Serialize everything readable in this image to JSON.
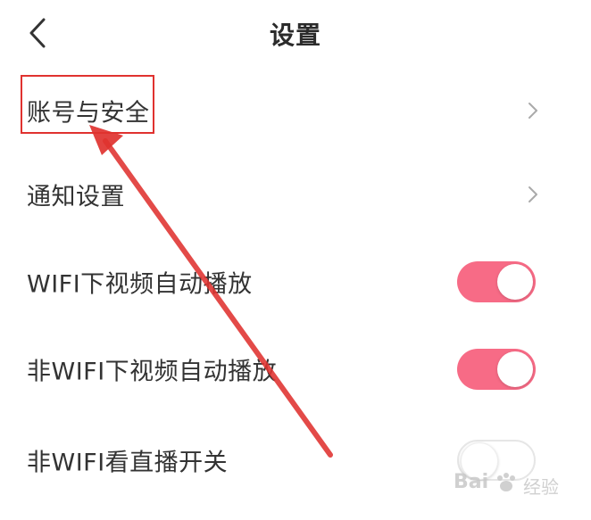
{
  "header": {
    "title": "设置",
    "back_icon": "chevron-left-icon"
  },
  "rows": [
    {
      "label": "账号与安全",
      "control": "chevron",
      "icon": "chevron-right-icon"
    },
    {
      "label": "通知设置",
      "control": "chevron",
      "icon": "chevron-right-icon"
    },
    {
      "label": "WIFI下视频自动播放",
      "control": "toggle",
      "state": "on"
    },
    {
      "label": "非WIFI下视频自动播放",
      "control": "toggle",
      "state": "on"
    },
    {
      "label": "非WIFI看直播开关",
      "control": "toggle",
      "state": "off"
    }
  ],
  "colors": {
    "toggle_on": "#f76b86",
    "annotation_red": "#e0322f",
    "text": "#333333"
  },
  "watermark": {
    "brand": "Bai",
    "sub": "经验"
  }
}
